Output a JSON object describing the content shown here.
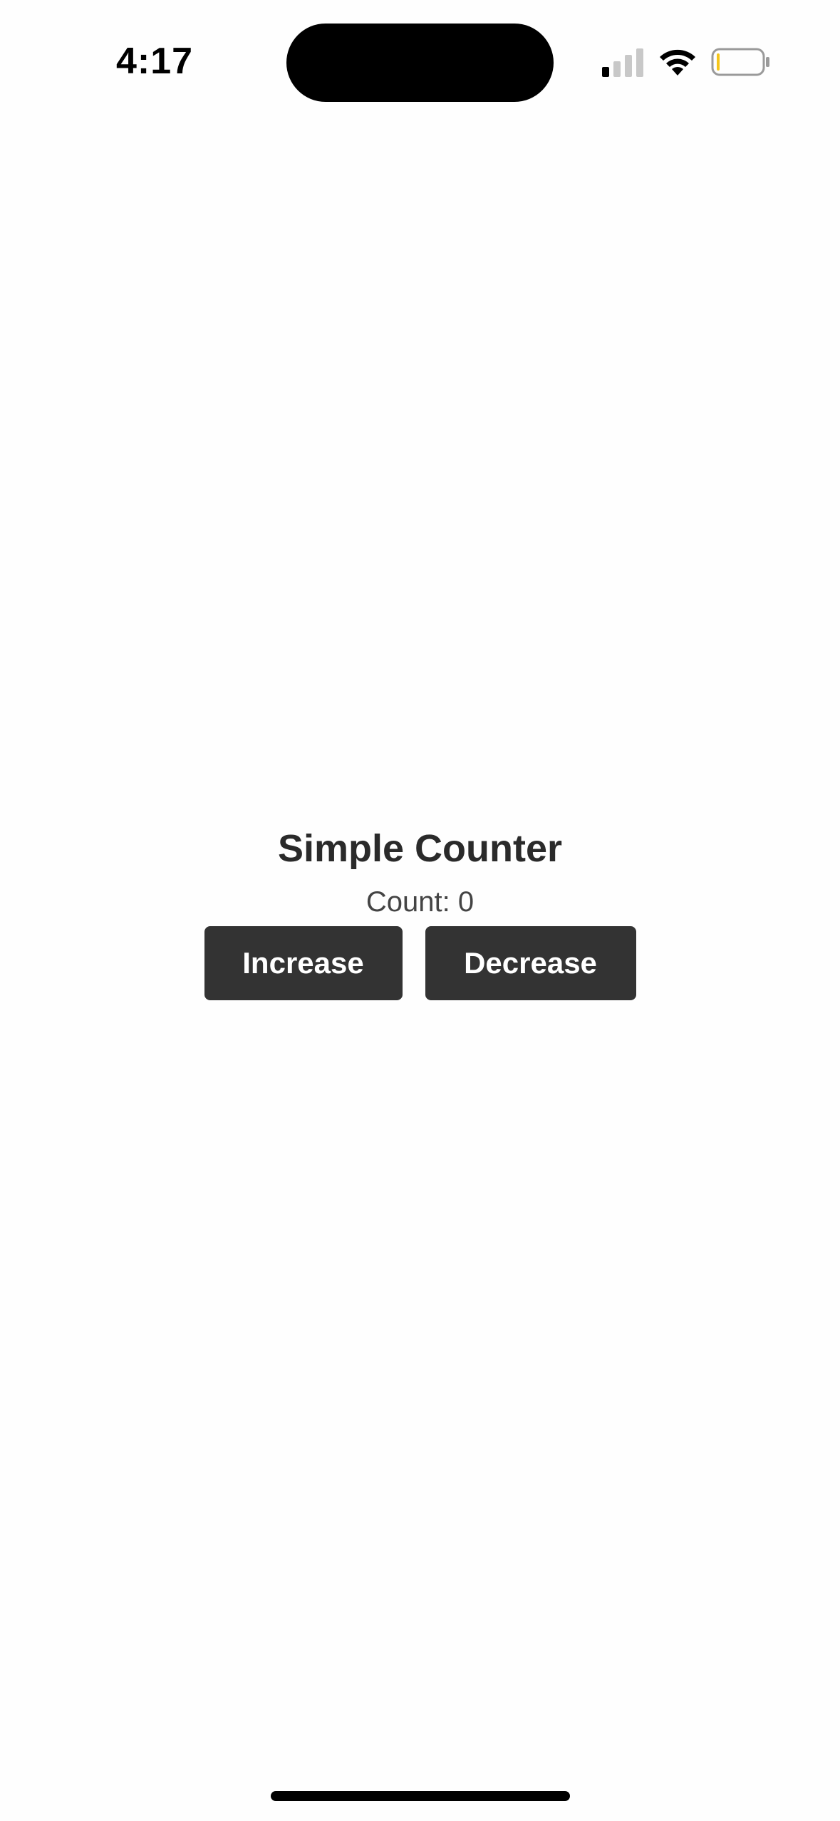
{
  "status_bar": {
    "time": "4:17",
    "signal_icon": "cellular-signal-icon",
    "wifi_icon": "wifi-icon",
    "battery_icon": "battery-low-icon",
    "battery_level": 0.05,
    "battery_accent": "#f5c518"
  },
  "main": {
    "title": "Simple Counter",
    "count_label": "Count: 0",
    "increase_label": "Increase",
    "decrease_label": "Decrease"
  },
  "colors": {
    "background": "#fefefe",
    "button_bg": "#333333",
    "button_text": "#ffffff",
    "title_text": "#2a2a2a"
  }
}
